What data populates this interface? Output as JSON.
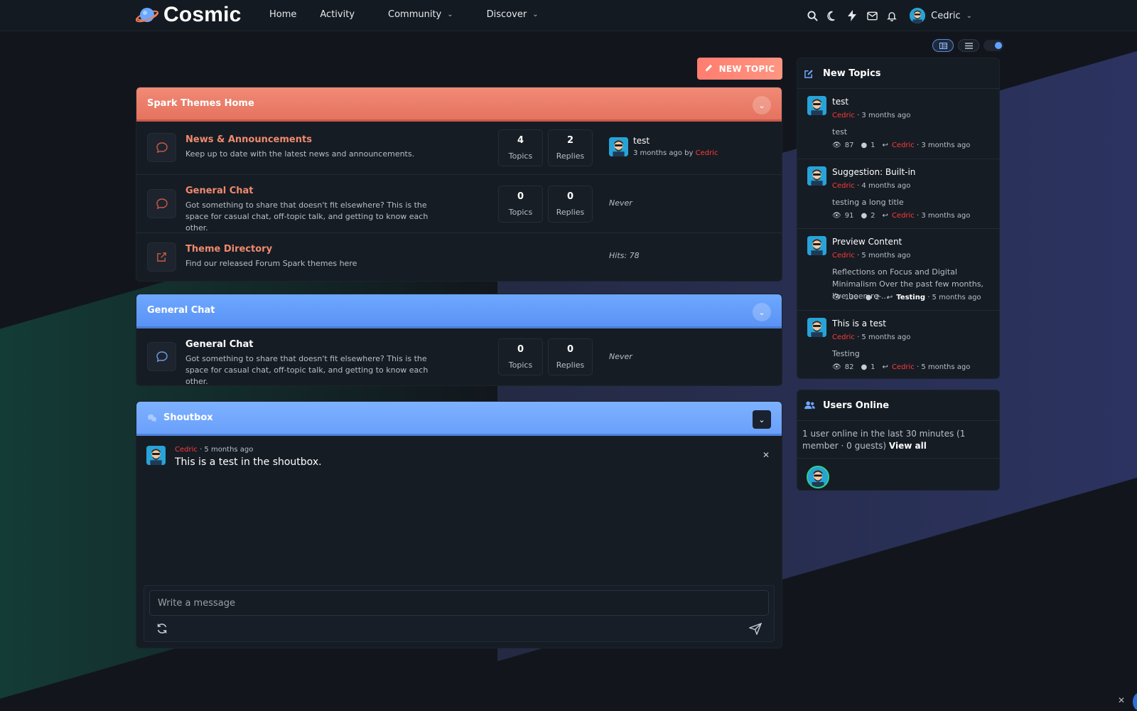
{
  "brand": {
    "name": "Cosmic"
  },
  "nav": {
    "links": [
      {
        "label": "Home"
      },
      {
        "label": "Activity"
      },
      {
        "label": "Community"
      },
      {
        "label": "Discover"
      }
    ],
    "user": {
      "name": "Cedric"
    }
  },
  "toolbar": {
    "new_topic_label": "NEW TOPIC"
  },
  "categories": [
    {
      "title": "Spark Themes Home",
      "forums": [
        {
          "title": "News & Announcements",
          "desc": "Keep up to date with the latest news and announcements.",
          "topics": "4",
          "topics_label": "Topics",
          "replies": "2",
          "replies_label": "Replies",
          "last_title": "test",
          "last_time": "3 months ago by",
          "last_user": "Cedric"
        },
        {
          "title": "General Chat",
          "desc": "Got something to share that doesn't fit elsewhere? This is the space for casual chat, off-topic talk, and getting to know each other.",
          "topics": "0",
          "topics_label": "Topics",
          "replies": "0",
          "replies_label": "Replies",
          "last": "Never"
        },
        {
          "title": "Theme Directory",
          "desc": "Find our released Forum Spark themes here",
          "hits": "Hits: 78"
        }
      ]
    },
    {
      "title": "General Chat",
      "forums": [
        {
          "title": "General Chat",
          "desc": "Got something to share that doesn't fit elsewhere? This is the space for casual chat, off-topic talk, and getting to know each other.",
          "topics": "0",
          "topics_label": "Topics",
          "replies": "0",
          "replies_label": "Replies",
          "last": "Never"
        }
      ]
    }
  ],
  "shoutbox": {
    "title": "Shoutbox",
    "messages": [
      {
        "user": "Cedric",
        "time": "· 5 months ago",
        "text": "This is a test in the shoutbox."
      }
    ],
    "placeholder": "Write a message"
  },
  "new_topics": {
    "title": "New Topics",
    "items": [
      {
        "title": "test",
        "user": "Cedric",
        "time": "· 3 months ago",
        "excerpt": "test",
        "views": "87",
        "comments": "1",
        "reply_user": "Cedric",
        "reply_time": "· 3 months ago"
      },
      {
        "title": "Suggestion: Built-in",
        "user": "Cedric",
        "time": "· 4 months ago",
        "excerpt": "testing a long title",
        "views": "91",
        "comments": "2",
        "reply_user": "Cedric",
        "reply_time": "· 3 months ago"
      },
      {
        "title": "Preview Content",
        "user": "Cedric",
        "time": "· 5 months ago",
        "excerpt": "Reflections on Focus and Digital Minimalism Over the past few months, I've been re-...",
        "views": "130",
        "comments": "2",
        "reply_user": "Testing",
        "reply_time": "· 5 months ago"
      },
      {
        "title": "This is a test",
        "user": "Cedric",
        "time": "· 5 months ago",
        "excerpt": "Testing",
        "views": "82",
        "comments": "1",
        "reply_user": "Cedric",
        "reply_time": "· 5 months ago"
      }
    ]
  },
  "users_online": {
    "title": "Users Online",
    "text": "1 user online in the last 30 minutes (1 member · 0 guests)",
    "view_all": "View all"
  },
  "colors": {
    "accent_orange": "#f08a76",
    "accent_blue": "#6ea8ff",
    "username_red": "#ff3b3b",
    "background": "#12161c"
  }
}
